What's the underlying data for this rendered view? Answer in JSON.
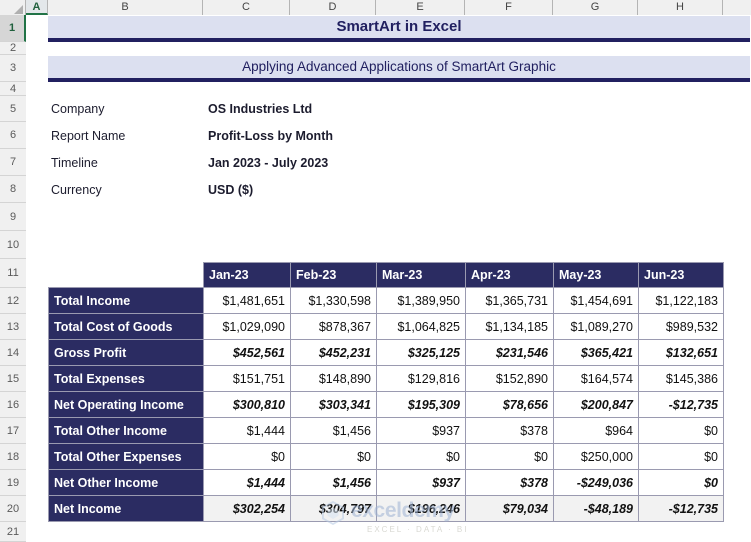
{
  "app": {
    "type": "spreadsheet",
    "name_tag": "excel-worksheet"
  },
  "grid": {
    "column_letters": [
      "A",
      "B",
      "C",
      "D",
      "E",
      "F",
      "G",
      "H"
    ],
    "selected_column": "A",
    "selected_row": "1",
    "row_numbers": [
      "1",
      "2",
      "3",
      "4",
      "5",
      "6",
      "7",
      "8",
      "9",
      "10",
      "11",
      "12",
      "13",
      "14",
      "15",
      "16",
      "17",
      "18",
      "19",
      "20",
      "21"
    ]
  },
  "banners": {
    "title": "SmartArt in Excel",
    "subtitle": "Applying Advanced Applications of SmartArt Graphic",
    "accent_color": "#212060",
    "fill_color": "#dce0f0"
  },
  "info": {
    "rows": [
      {
        "label": "Company",
        "value": "OS Industries Ltd"
      },
      {
        "label": "Report Name",
        "value": "Profit-Loss by Month"
      },
      {
        "label": "Timeline",
        "value": "Jan 2023 - July 2023"
      },
      {
        "label": "Currency",
        "value": "USD ($)"
      }
    ]
  },
  "table": {
    "header_fill": "#2b2c62",
    "columns": [
      "Jan-23",
      "Feb-23",
      "Mar-23",
      "Apr-23",
      "May-23",
      "Jun-23"
    ],
    "rows": [
      {
        "label": "Total Income",
        "style": "plain",
        "values": [
          "$1,481,651",
          "$1,330,598",
          "$1,389,950",
          "$1,365,731",
          "$1,454,691",
          "$1,122,183"
        ]
      },
      {
        "label": "Total Cost of Goods",
        "style": "plain",
        "values": [
          "$1,029,090",
          "$878,367",
          "$1,064,825",
          "$1,134,185",
          "$1,089,270",
          "$989,532"
        ]
      },
      {
        "label": "Gross Profit",
        "style": "italic",
        "values": [
          "$452,561",
          "$452,231",
          "$325,125",
          "$231,546",
          "$365,421",
          "$132,651"
        ]
      },
      {
        "label": "Total Expenses",
        "style": "plain",
        "values": [
          "$151,751",
          "$148,890",
          "$129,816",
          "$152,890",
          "$164,574",
          "$145,386"
        ]
      },
      {
        "label": "Net Operating Income",
        "style": "italic",
        "values": [
          "$300,810",
          "$303,341",
          "$195,309",
          "$78,656",
          "$200,847",
          "-$12,735"
        ]
      },
      {
        "label": "Total Other Income",
        "style": "plain",
        "values": [
          "$1,444",
          "$1,456",
          "$937",
          "$378",
          "$964",
          "$0"
        ]
      },
      {
        "label": "Total Other Expenses",
        "style": "plain",
        "values": [
          "$0",
          "$0",
          "$0",
          "$0",
          "$250,000",
          "$0"
        ]
      },
      {
        "label": "Net Other Income",
        "style": "italic",
        "values": [
          "$1,444",
          "$1,456",
          "$937",
          "$378",
          "-$249,036",
          "$0"
        ]
      },
      {
        "label": "Net Income",
        "style": "total",
        "values": [
          "$302,254",
          "$304,797",
          "$196,246",
          "$79,034",
          "-$48,189",
          "-$12,735"
        ],
        "signs": [
          "pos",
          "pos",
          "pos",
          "pos",
          "neg",
          "neg"
        ]
      }
    ],
    "positive_color": "#1f6b34",
    "negative_color": "#d61a1a"
  },
  "watermark": {
    "brand": "exceldemy",
    "tagline": "EXCEL · DATA · BI"
  }
}
